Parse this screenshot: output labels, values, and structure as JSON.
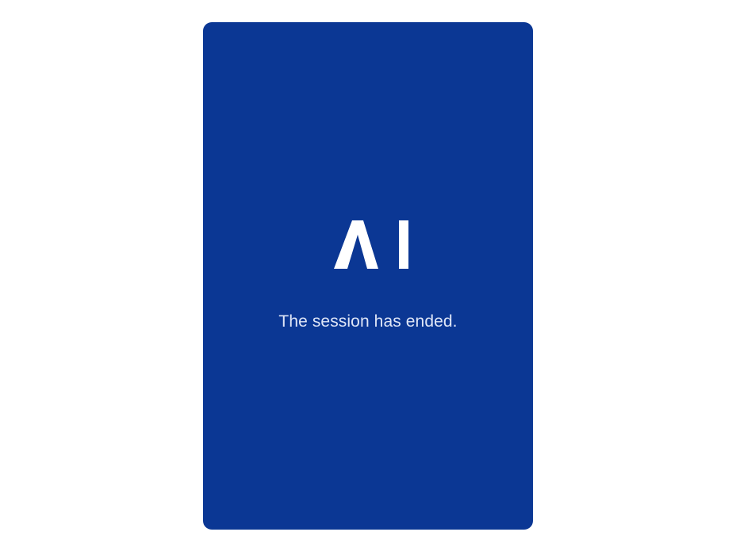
{
  "session": {
    "message": "The session has ended."
  },
  "brand": {
    "logo_icon": "ai-logo-icon",
    "logo_text": "AI"
  },
  "colors": {
    "page_background": "#ffffff",
    "card_background": "#0b3794",
    "logo": "#ffffff",
    "message_text": "#dfe6f7"
  }
}
